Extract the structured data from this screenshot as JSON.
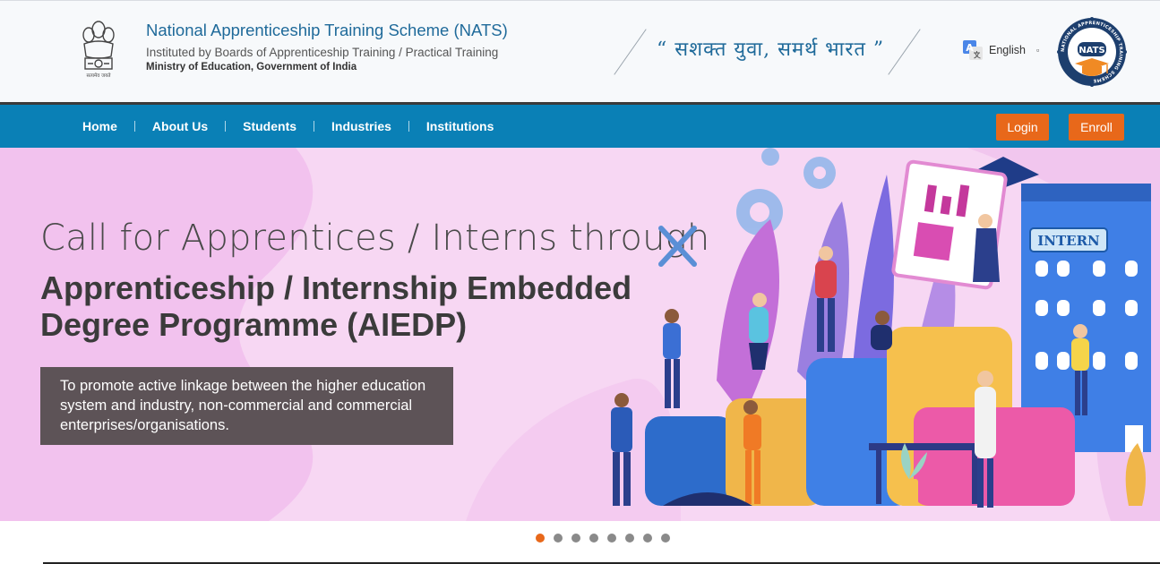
{
  "header": {
    "title": "National Apprenticeship Training Scheme (NATS)",
    "subtitle": "Instituted by Boards of Apprenticeship Training / Practical Training",
    "ministry": "Ministry of Education, Government of India",
    "tagline": "“ सशक्त युवा, समर्थ भारत ”",
    "language": "English",
    "emblem_caption": "सत्यमेव जयते",
    "logo_ring_text": "NATIONAL APPRENTICESHIP TRAINING SCHEME",
    "logo_center": "NATS"
  },
  "nav": {
    "items": [
      "Home",
      "About Us",
      "Students",
      "Industries",
      "Institutions"
    ],
    "login_label": "Login",
    "enroll_label": "Enroll"
  },
  "hero": {
    "line1": "Call for Apprentices / Interns through",
    "line2a": "Apprenticeship / Internship Embedded",
    "line2b": "Degree Programme (AIEDP)",
    "description": "To promote active linkage between the higher education system and industry, non-commercial and commercial enterprises/organisations.",
    "building_sign": "INTERN"
  },
  "carousel": {
    "slide_count": 8,
    "active_index": 0
  },
  "colors": {
    "nav_bg": "#0a80b6",
    "accent": "#e8681a",
    "title_blue": "#1f6a9a",
    "hero_bg": "#f7d7f3"
  }
}
